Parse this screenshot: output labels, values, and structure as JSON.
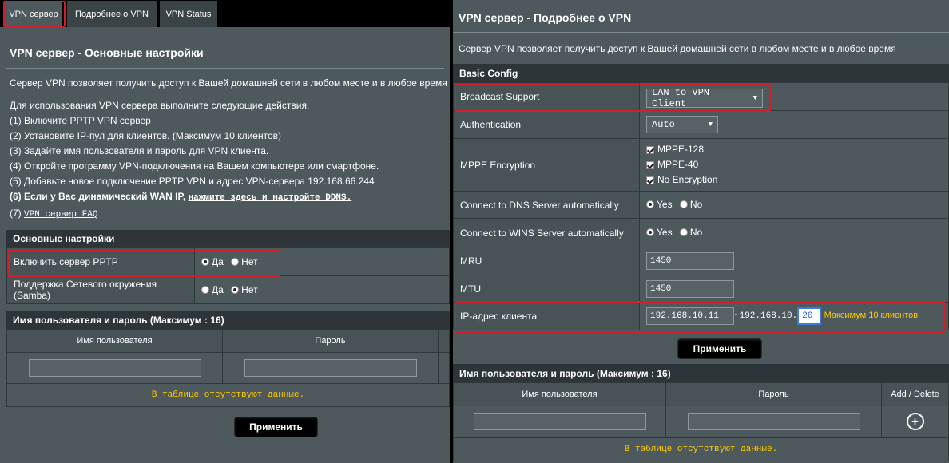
{
  "left": {
    "tabs": [
      "VPN сервер",
      "Подробнее о VPN",
      "VPN Status"
    ],
    "title": "VPN сервер - Основные настройки",
    "intro": "Сервер VPN позволяет получить доступ к Вашей домашней сети в любом месте и в любое время",
    "steps_heading": "Для использования VPN сервера выполните следующие действия.",
    "steps": [
      "(1) Включите PPTP VPN сервер",
      "(2) Установите IP-пул для клиентов. (Максимум 10 клиентов)",
      "(3) Задайте имя пользователя и пароль для VPN клиента.",
      "(4) Откройте программу VPN-подключения на Вашем компьютере или смартфоне.",
      "(5) Добавьте новое подключение PPTP VPN и адрес VPN-сервера 192.168.66.244"
    ],
    "step6_text": "(6) Если у Вас динамический WAN IP, ",
    "step6_link": "нажмите здесь и настройте DDNS.",
    "step7_text": "(7) ",
    "step7_link": "VPN сервер FAQ",
    "basic_section": "Основные настройки",
    "rows": [
      {
        "label": "Включить сервер PPTP",
        "opt_yes": "Да",
        "opt_no": "Нет",
        "selected": "yes"
      },
      {
        "label": "Поддержка Сетевого окружения (Samba)",
        "opt_yes": "Да",
        "opt_no": "Нет",
        "selected": "no"
      }
    ],
    "users_section": "Имя пользователя и пароль (Максимум : 16)",
    "col_user": "Имя пользователя",
    "col_pass": "Пароль",
    "empty": "В таблице отсутствуют данные.",
    "apply": "Применить"
  },
  "right": {
    "title": "VPN сервер - Подробнее о VPN",
    "intro": "Сервер VPN позволяет получить доступ к Вашей домашней сети в любом месте и в любое время",
    "basic_section": "Basic Config",
    "broadcast_label": "Broadcast Support",
    "broadcast_value": "LAN to VPN Client",
    "auth_label": "Authentication",
    "auth_value": "Auto",
    "mppe_label": "MPPE Encryption",
    "mppe_options": [
      "MPPE-128",
      "MPPE-40",
      "No Encryption"
    ],
    "dns_label": "Connect to DNS Server automatically",
    "wins_label": "Connect to WINS Server automatically",
    "opt_yes": "Yes",
    "opt_no": "No",
    "mru_label": "MRU",
    "mru_value": "1450",
    "mtu_label": "MTU",
    "mtu_value": "1450",
    "ip_label": "IP-адрес клиента",
    "ip_start": "192.168.10.11",
    "ip_sep": "~192.168.10.",
    "ip_end": "20",
    "ip_hint": "Максимум 10 клиентов",
    "apply": "Применить",
    "users_section": "Имя пользователя и пароль (Максимум : 16)",
    "col_user": "Имя пользователя",
    "col_pass": "Пароль",
    "col_add": "Add / Delete",
    "empty": "В таблице отсутствуют данные."
  },
  "colors": {
    "panel": "#4d595d",
    "section_header": "#2d3538",
    "highlight": "#d11f2a",
    "warning_text": "#ffcc00"
  }
}
